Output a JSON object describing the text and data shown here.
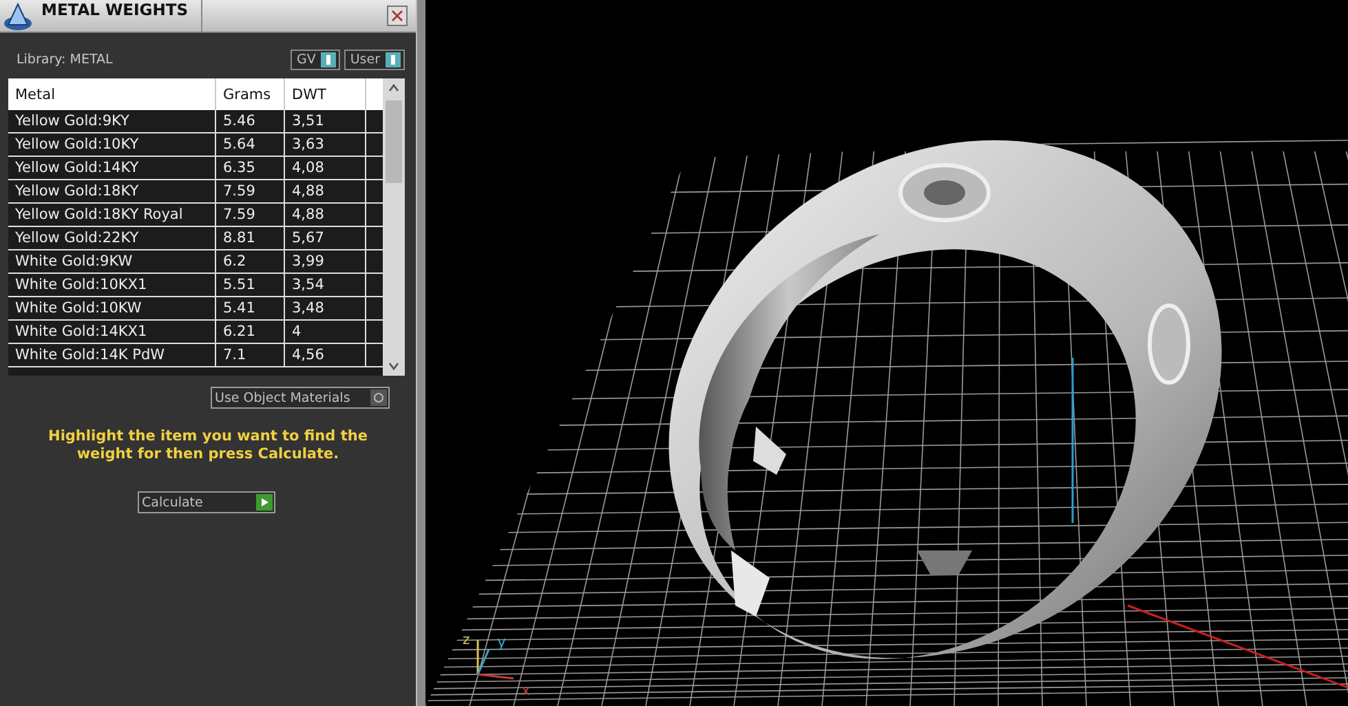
{
  "panel": {
    "title": "METAL WEIGHTS",
    "library": "Library: METAL",
    "toggles": [
      {
        "label": "GV",
        "on": true
      },
      {
        "label": "User",
        "on": true
      }
    ],
    "table": {
      "columns": [
        "Metal",
        "Grams",
        "DWT"
      ],
      "rows": [
        [
          "Yellow Gold:9KY",
          "5.46",
          "3,51"
        ],
        [
          "Yellow Gold:10KY",
          "5.64",
          "3,63"
        ],
        [
          "Yellow Gold:14KY",
          "6.35",
          "4,08"
        ],
        [
          "Yellow Gold:18KY",
          "7.59",
          "4,88"
        ],
        [
          "Yellow Gold:18KY Royal",
          "7.59",
          "4,88"
        ],
        [
          "Yellow Gold:22KY",
          "8.81",
          "5,67"
        ],
        [
          "White Gold:9KW",
          "6.2",
          "3,99"
        ],
        [
          "White Gold:10KX1",
          "5.51",
          "3,54"
        ],
        [
          "White Gold:10KW",
          "5.41",
          "3,48"
        ],
        [
          "White Gold:14KX1",
          "6.21",
          "4"
        ],
        [
          "White Gold:14K PdW",
          "7.1",
          "4,56"
        ]
      ]
    },
    "use_object_materials": {
      "label": "Use Object Materials",
      "checked": false
    },
    "hint": "Highlight the item you want to find the weight for then press Calculate.",
    "calculate": "Calculate"
  },
  "viewport": {
    "axes": [
      {
        "label": "z",
        "color": "#d8c050"
      },
      {
        "label": "y",
        "color": "#3aa8c8"
      },
      {
        "label": "x",
        "color": "#c83a3a"
      }
    ]
  }
}
